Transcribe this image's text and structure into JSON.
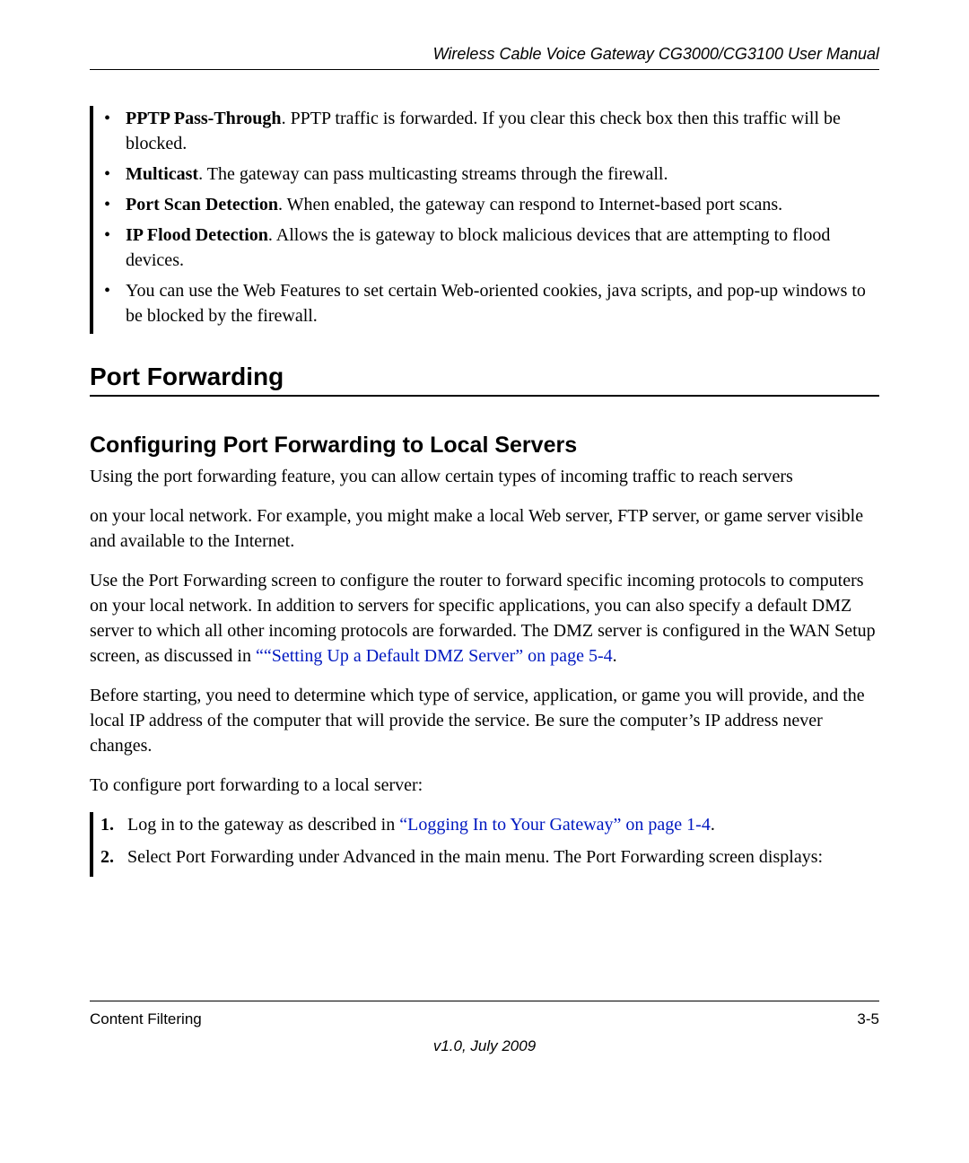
{
  "header": {
    "doc_title": "Wireless Cable Voice Gateway CG3000/CG3100 User Manual"
  },
  "bullets": {
    "b1_bold": "PPTP Pass-Through",
    "b1_rest": ". PPTP traffic is forwarded. If you clear this check box then this traffic will be blocked.",
    "b2_bold": "Multicast",
    "b2_rest": ". The gateway can pass multicasting streams through the firewall.",
    "b3_bold": "Port Scan Detection",
    "b3_rest": ". When enabled, the gateway can respond to Internet-based port scans.",
    "b4_bold": "IP Flood Detection",
    "b4_rest": ". Allows the is gateway to block malicious devices that are attempting to flood devices.",
    "b5": "You can use the Web Features to set certain Web-oriented cookies, java scripts, and pop-up windows to be blocked by the firewall."
  },
  "section": {
    "heading": "Port Forwarding",
    "subheading": "Configuring Port Forwarding to Local Servers"
  },
  "paragraphs": {
    "p1": "Using the port forwarding feature, you can allow certain types of incoming traffic to reach servers",
    "p2": "on your local network. For example, you might make a local Web server, FTP server, or game server visible and available to the Internet.",
    "p3_a": "Use the Port Forwarding screen to configure the router to forward specific incoming protocols to computers on your local network. In addition to servers for specific applications, you can also specify a default DMZ server to which all other incoming protocols are forwarded. The DMZ server is configured in the WAN Setup screen, as discussed in ",
    "p3_link": "““Setting Up a Default DMZ Server” on page 5-4",
    "p3_b": ".",
    "p4": "Before starting, you need to determine which type of service, application, or game you will provide, and the local IP address of the computer that will provide the service. Be sure the computer’s IP address never changes.",
    "p5": "To configure port forwarding to a local server:"
  },
  "steps": {
    "s1_a": "Log in to the gateway as described in ",
    "s1_link": "“Logging In to Your Gateway” on page 1-4",
    "s1_b": ".",
    "s2": "Select Port Forwarding under Advanced in the main menu. The Port Forwarding screen displays:"
  },
  "footer": {
    "section_name": "Content Filtering",
    "page_number": "3-5",
    "version": "v1.0, July 2009"
  }
}
